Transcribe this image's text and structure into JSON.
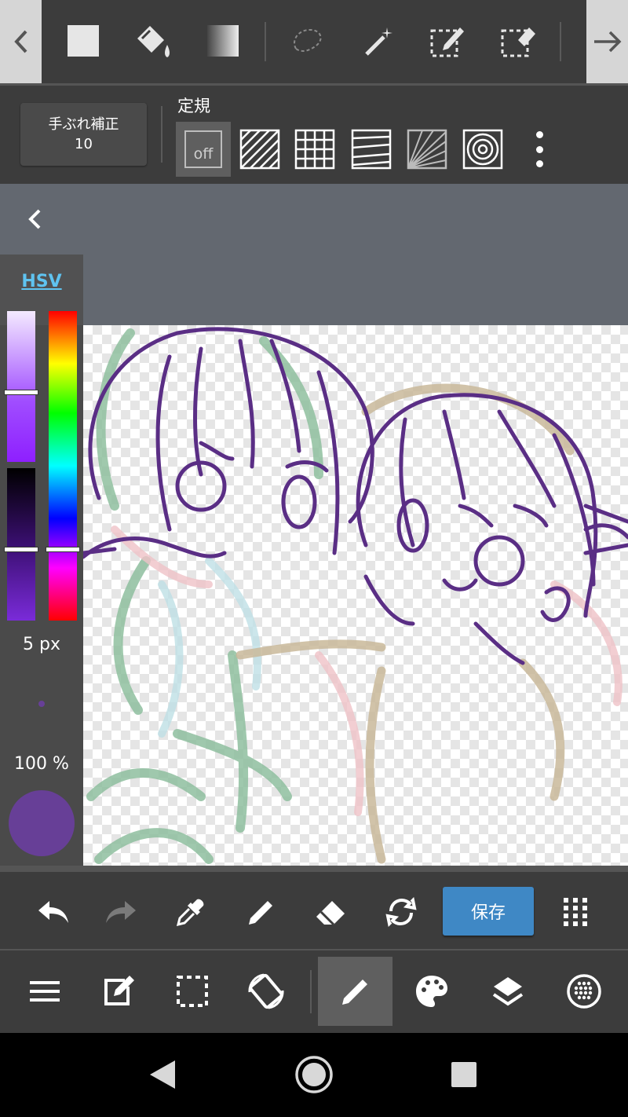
{
  "top_toolbar": {
    "tools": [
      "fill-rect-icon",
      "bucket-icon",
      "gradient-icon",
      "lasso-icon",
      "magic-wand-icon",
      "select-pen-icon",
      "select-eraser-icon"
    ]
  },
  "stabilizer": {
    "label": "手ぶれ補正",
    "value": "10"
  },
  "ruler": {
    "title": "定規",
    "off_label": "off"
  },
  "color_panel": {
    "mode_label": "HSV",
    "brush_size": "5 px",
    "opacity": "100 %",
    "current_color": "#673f97",
    "saturation_level": 0.27,
    "value_level": 0.52,
    "hue_level": 0.77
  },
  "actions": {
    "save_label": "保存"
  },
  "colors": {
    "toolbar_bg": "#3c3c3c",
    "canvas_bg_area": "#636870",
    "accent_blue": "#3f88c5",
    "hsv_link": "#5fc3f0",
    "line_purple": "#5a2e85",
    "sketch_green": "#8fbf9f",
    "sketch_tan": "#c9b99a",
    "sketch_pink": "#efc2c7"
  }
}
